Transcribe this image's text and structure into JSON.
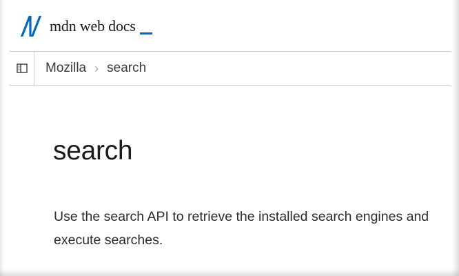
{
  "header": {
    "logo_text": "mdn web docs"
  },
  "breadcrumb": {
    "items": [
      "Mozilla",
      "search"
    ],
    "separator": "›"
  },
  "main": {
    "title": "search",
    "description": "Use the search API to retrieve the installed search engines and execute searches."
  },
  "colors": {
    "accent": "#0069c2",
    "text": "#1b1b1b",
    "border": "#cdcdcd"
  },
  "icons": {
    "logo": "mdn-logo-icon",
    "sidebar_toggle": "sidebar-toggle-icon"
  }
}
